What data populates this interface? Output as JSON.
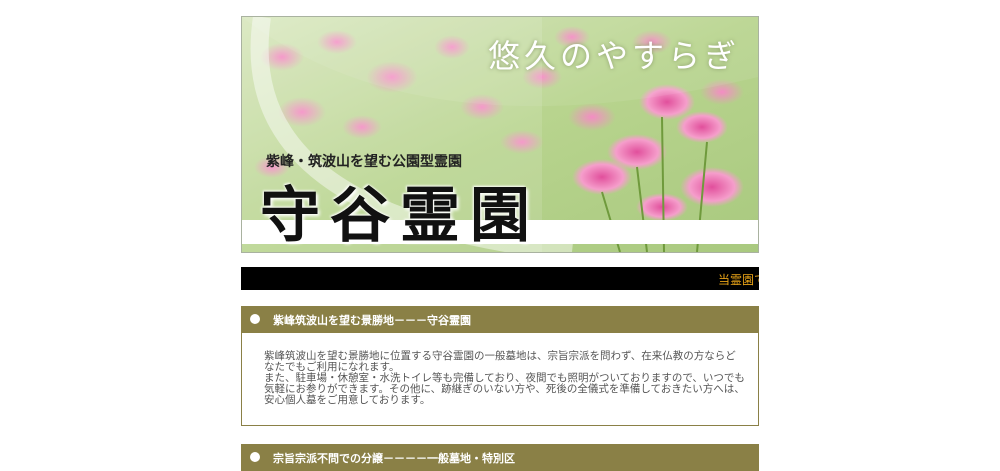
{
  "banner": {
    "tagline": "悠久のやすらぎ",
    "subtitle": "紫峰・筑波山を望む公園型霊園",
    "title": "守谷霊園"
  },
  "ticker": {
    "text": "当霊園で"
  },
  "sections": [
    {
      "heading": "紫峰筑波山を望む景勝地－－－守谷霊園",
      "paragraphs": [
        "紫峰筑波山を望む景勝地に位置する守谷霊園の一般墓地は、宗旨宗派を問わず、在来仏教の方ならどなたでもご利用になれます。",
        "また、駐車場・休憩室・水洗トイレ等も完備しており、夜間でも照明がついておりますので、いつでも気軽にお参りができます。その他に、跡継ぎのいない方や、死後の全儀式を準備しておきたい方へは、安心個人墓をご用意しております。"
      ]
    },
    {
      "heading": "宗旨宗派不問での分譲－－－－一般墓地・特別区"
    }
  ],
  "colors": {
    "section_header": "#8a8046",
    "ticker_bg": "#000000",
    "ticker_text": "#e8a317",
    "body_text": "#555555"
  }
}
